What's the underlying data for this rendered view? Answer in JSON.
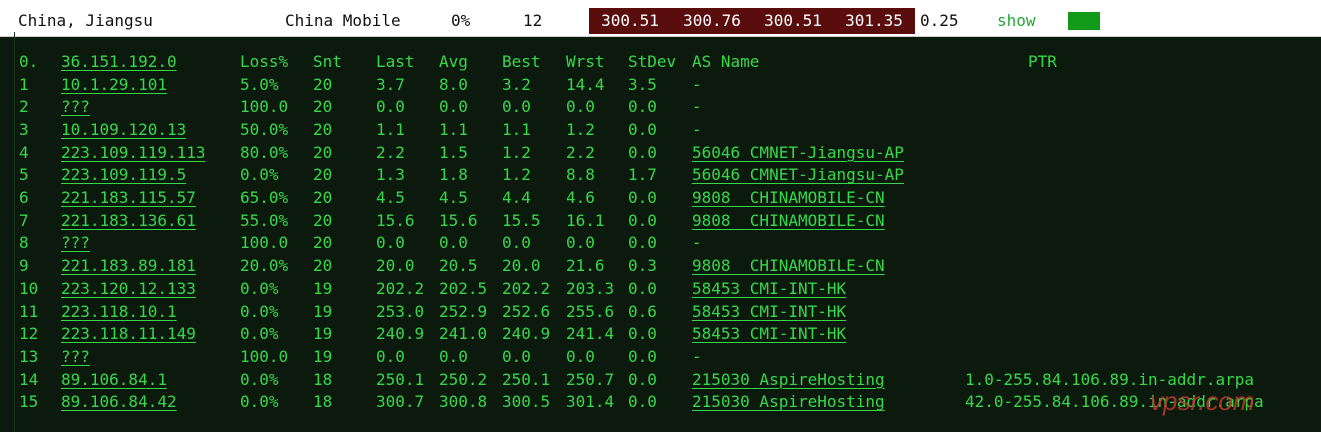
{
  "summary": {
    "location": "China, Jiangsu",
    "isp": "China Mobile",
    "loss": "0%",
    "sent": "12",
    "last": "300.51",
    "avg": "300.76",
    "best": "300.51",
    "worst": "301.35",
    "stdev": "0.25",
    "show_label": "show",
    "status_color": "#119a17"
  },
  "table": {
    "headers": {
      "host_index": "0.",
      "host": "36.151.192.0",
      "loss": "Loss%",
      "snt": "Snt",
      "last": "Last",
      "avg": "Avg",
      "best": "Best",
      "wrst": "Wrst",
      "stdev": "StDev",
      "as_name": "AS Name",
      "ptr": "PTR"
    },
    "rows": [
      {
        "hop": "1",
        "host": "10.1.29.101",
        "loss": "5.0%",
        "snt": "20",
        "last": "3.7",
        "avg": "8.0",
        "best": "3.2",
        "wrst": "14.4",
        "stdev": "3.5",
        "as": "-",
        "ptr": ""
      },
      {
        "hop": "2",
        "host": "???",
        "loss": "100.0",
        "snt": "20",
        "last": "0.0",
        "avg": "0.0",
        "best": "0.0",
        "wrst": "0.0",
        "stdev": "0.0",
        "as": "-",
        "ptr": ""
      },
      {
        "hop": "3",
        "host": "10.109.120.13",
        "loss": "50.0%",
        "snt": "20",
        "last": "1.1",
        "avg": "1.1",
        "best": "1.1",
        "wrst": "1.2",
        "stdev": "0.0",
        "as": "-",
        "ptr": ""
      },
      {
        "hop": "4",
        "host": "223.109.119.113",
        "loss": "80.0%",
        "snt": "20",
        "last": "2.2",
        "avg": "1.5",
        "best": "1.2",
        "wrst": "2.2",
        "stdev": "0.0",
        "as": "56046 CMNET-Jiangsu-AP",
        "ptr": ""
      },
      {
        "hop": "5",
        "host": "223.109.119.5",
        "loss": "0.0%",
        "snt": "20",
        "last": "1.3",
        "avg": "1.8",
        "best": "1.2",
        "wrst": "8.8",
        "stdev": "1.7",
        "as": "56046 CMNET-Jiangsu-AP",
        "ptr": ""
      },
      {
        "hop": "6",
        "host": "221.183.115.57",
        "loss": "65.0%",
        "snt": "20",
        "last": "4.5",
        "avg": "4.5",
        "best": "4.4",
        "wrst": "4.6",
        "stdev": "0.0",
        "as": "9808  CHINAMOBILE-CN",
        "ptr": ""
      },
      {
        "hop": "7",
        "host": "221.183.136.61",
        "loss": "55.0%",
        "snt": "20",
        "last": "15.6",
        "avg": "15.6",
        "best": "15.5",
        "wrst": "16.1",
        "stdev": "0.0",
        "as": "9808  CHINAMOBILE-CN",
        "ptr": ""
      },
      {
        "hop": "8",
        "host": "???",
        "loss": "100.0",
        "snt": "20",
        "last": "0.0",
        "avg": "0.0",
        "best": "0.0",
        "wrst": "0.0",
        "stdev": "0.0",
        "as": "-",
        "ptr": ""
      },
      {
        "hop": "9",
        "host": "221.183.89.181",
        "loss": "20.0%",
        "snt": "20",
        "last": "20.0",
        "avg": "20.5",
        "best": "20.0",
        "wrst": "21.6",
        "stdev": "0.3",
        "as": "9808  CHINAMOBILE-CN",
        "ptr": ""
      },
      {
        "hop": "10",
        "host": "223.120.12.133",
        "loss": "0.0%",
        "snt": "19",
        "last": "202.2",
        "avg": "202.5",
        "best": "202.2",
        "wrst": "203.3",
        "stdev": "0.0",
        "as": "58453 CMI-INT-HK",
        "ptr": ""
      },
      {
        "hop": "11",
        "host": "223.118.10.1",
        "loss": "0.0%",
        "snt": "19",
        "last": "253.0",
        "avg": "252.9",
        "best": "252.6",
        "wrst": "255.6",
        "stdev": "0.6",
        "as": "58453 CMI-INT-HK",
        "ptr": ""
      },
      {
        "hop": "12",
        "host": "223.118.11.149",
        "loss": "0.0%",
        "snt": "19",
        "last": "240.9",
        "avg": "241.0",
        "best": "240.9",
        "wrst": "241.4",
        "stdev": "0.0",
        "as": "58453 CMI-INT-HK",
        "ptr": ""
      },
      {
        "hop": "13",
        "host": "???",
        "loss": "100.0",
        "snt": "19",
        "last": "0.0",
        "avg": "0.0",
        "best": "0.0",
        "wrst": "0.0",
        "stdev": "0.0",
        "as": "-",
        "ptr": ""
      },
      {
        "hop": "14",
        "host": "89.106.84.1",
        "loss": "0.0%",
        "snt": "18",
        "last": "250.1",
        "avg": "250.2",
        "best": "250.1",
        "wrst": "250.7",
        "stdev": "0.0",
        "as": "215030 AspireHosting",
        "ptr": "1.0-255.84.106.89.in-addr.arpa"
      },
      {
        "hop": "15",
        "host": "89.106.84.42",
        "loss": "0.0%",
        "snt": "18",
        "last": "300.7",
        "avg": "300.8",
        "best": "300.5",
        "wrst": "301.4",
        "stdev": "0.0",
        "as": "215030 AspireHosting",
        "ptr": "42.0-255.84.106.89.in-addr.arpa"
      }
    ]
  },
  "watermark": "vpsr.com"
}
